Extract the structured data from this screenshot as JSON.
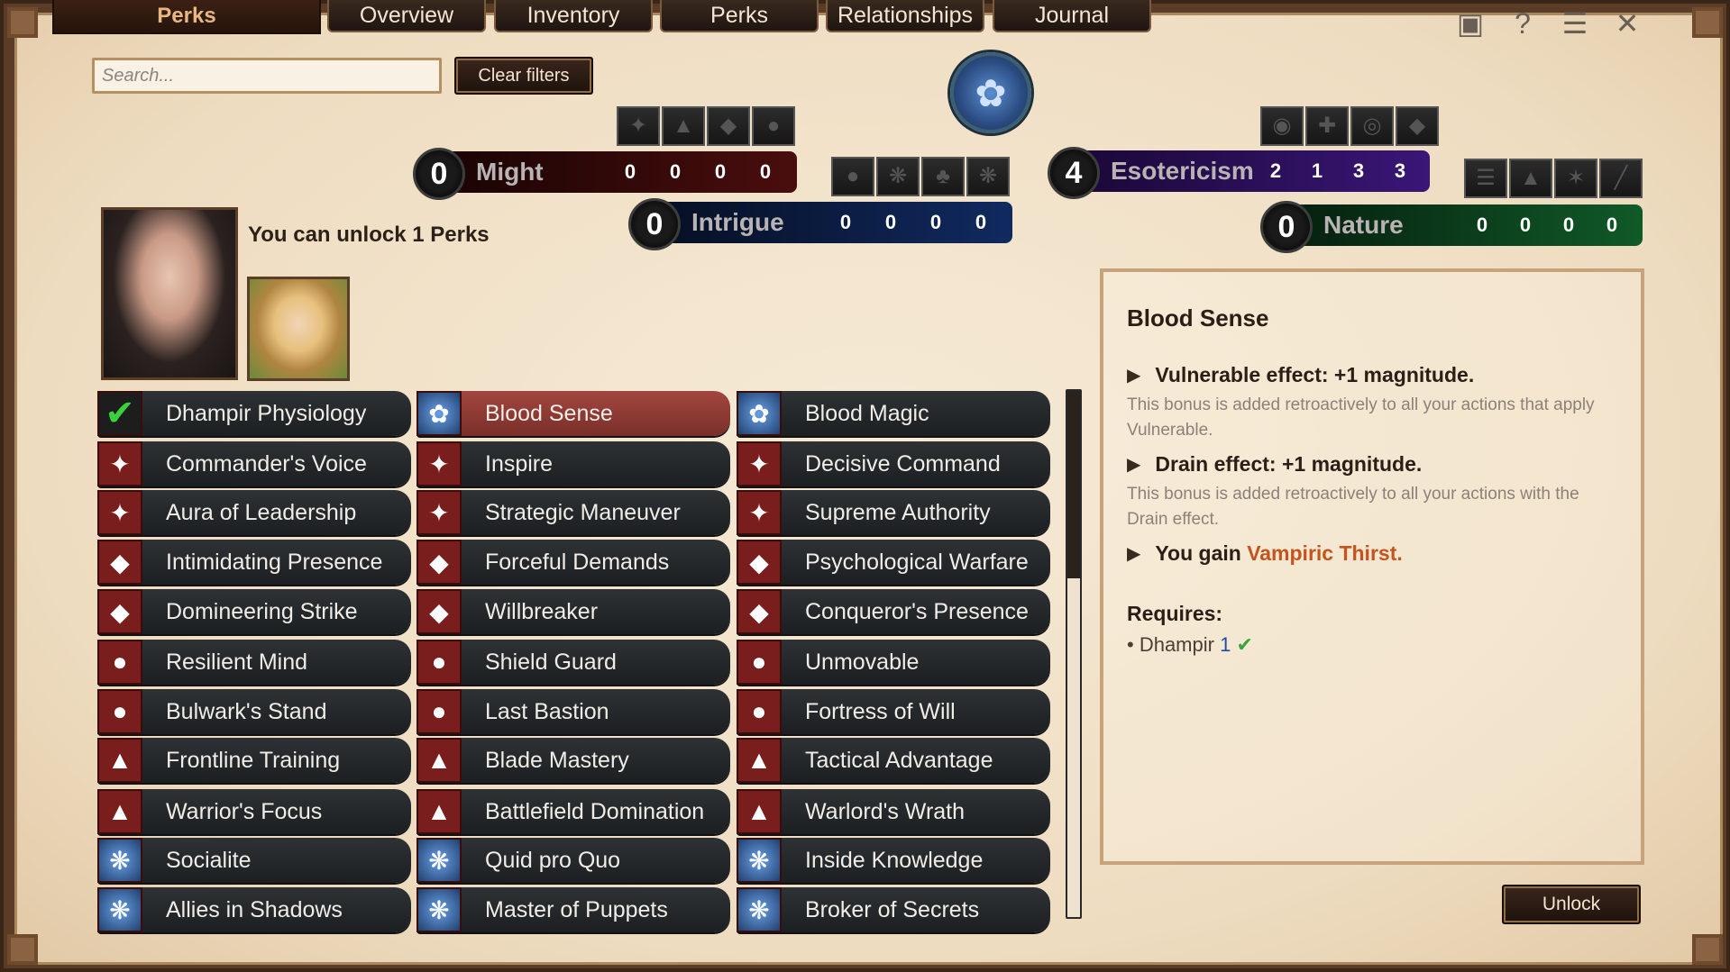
{
  "tabs": {
    "active": "Perks",
    "items": [
      "Overview",
      "Inventory",
      "Perks",
      "Relationships",
      "Journal"
    ]
  },
  "top_icons": [
    "map-icon",
    "help-icon",
    "menu-icon",
    "close-icon"
  ],
  "search": {
    "placeholder": "Search...",
    "value": ""
  },
  "clear_filters_label": "Clear filters",
  "stats": {
    "might": {
      "label": "Might",
      "level": "0",
      "values": [
        "0",
        "0",
        "0",
        "0"
      ],
      "color": "#3a0b0b"
    },
    "intrigue": {
      "label": "Intrigue",
      "level": "0",
      "values": [
        "0",
        "0",
        "0",
        "0"
      ],
      "color": "#0b1f45"
    },
    "esotericism": {
      "label": "Esotericism",
      "level": "4",
      "values": [
        "2",
        "1",
        "3",
        "3"
      ],
      "color": "#2b0f55"
    },
    "nature": {
      "label": "Nature",
      "level": "0",
      "values": [
        "0",
        "0",
        "0",
        "0"
      ],
      "color": "#0c3a1c"
    }
  },
  "unlock_text": "You can unlock 1 Perks",
  "perks": [
    [
      "Dhampir Physiology",
      "Blood Sense",
      "Blood Magic"
    ],
    [
      "Commander's Voice",
      "Inspire",
      "Decisive Command"
    ],
    [
      "Aura of Leadership",
      "Strategic Maneuver",
      "Supreme Authority"
    ],
    [
      "Intimidating Presence",
      "Forceful Demands",
      "Psychological Warfare"
    ],
    [
      "Domineering Strike",
      "Willbreaker",
      "Conqueror's Presence"
    ],
    [
      "Resilient Mind",
      "Shield Guard",
      "Unmovable"
    ],
    [
      "Bulwark's Stand",
      "Last Bastion",
      "Fortress of Will"
    ],
    [
      "Frontline Training",
      "Blade Mastery",
      "Tactical Advantage"
    ],
    [
      "Warrior's Focus",
      "Battlefield Domination",
      "Warlord's Wrath"
    ],
    [
      "Socialite",
      "Quid pro Quo",
      "Inside Knowledge"
    ],
    [
      "Allies in Shadows",
      "Master of Puppets",
      "Broker of Secrets"
    ]
  ],
  "perk_row_icons": [
    "dna-icon",
    "eagle-icon",
    "eagle-icon",
    "dragon-icon",
    "dragon-icon",
    "strongman-icon",
    "strongman-icon",
    "helmet-icon",
    "helmet-icon",
    "web-icon",
    "web-icon"
  ],
  "detail": {
    "title": "Blood Sense",
    "effects": [
      {
        "head": "Vulnerable effect: +1 magnitude.",
        "desc": "This bonus is added retroactively to all your actions that apply Vulnerable."
      },
      {
        "head": "Drain effect: +1 magnitude.",
        "desc": "This bonus is added retroactively to all your actions with the Drain effect."
      }
    ],
    "gain_prefix": "You gain ",
    "gain_item": "Vampiric Thirst",
    "gain_suffix": ".",
    "requires_label": "Requires:",
    "requirement_name": "Dhampir",
    "requirement_level": "1"
  },
  "unlock_button": "Unlock"
}
